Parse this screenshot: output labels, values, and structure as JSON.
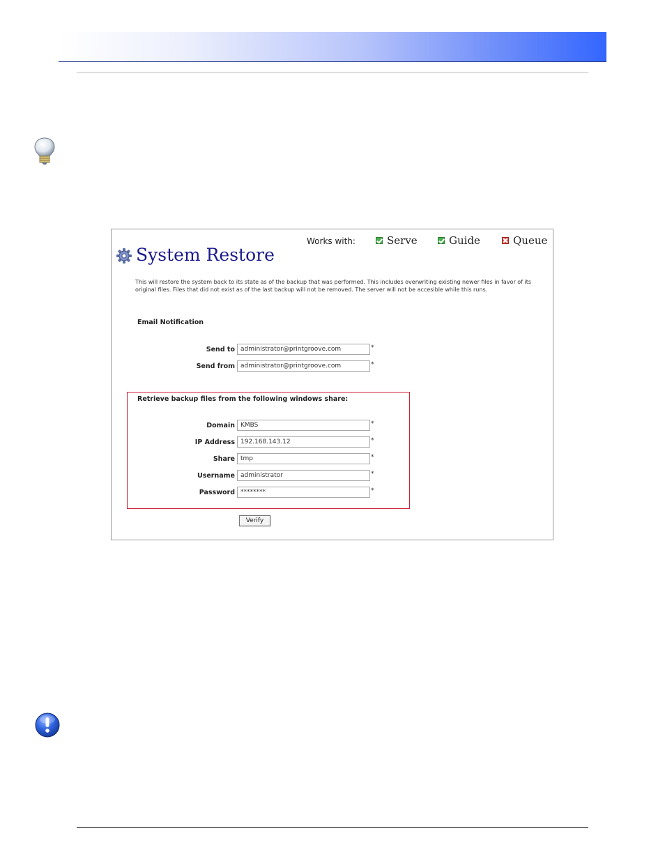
{
  "figure": {
    "title": "System Restore",
    "works_with_label": "Works with:",
    "products": [
      {
        "name": "Serve",
        "status": "supported"
      },
      {
        "name": "Guide",
        "status": "supported"
      },
      {
        "name": "Queue",
        "status": "not-supported"
      }
    ],
    "description": "This will restore the system back to its state as of the backup that was performed. This includes overwriting existing newer files in favor of its original files. Files that did not exist as of the last backup will not be removed. The server will not be accesible while this runs.",
    "email_section": {
      "heading": "Email Notification",
      "send_to_label": "Send to",
      "send_to_value": "administrator@printgroove.com",
      "send_from_label": "Send from",
      "send_from_value": "administrator@printgroove.com"
    },
    "share_section": {
      "heading": "Retrieve backup files from the following windows share:",
      "domain_label": "Domain",
      "domain_value": "KMBS",
      "ip_label": "IP Address",
      "ip_value": "192.168.143.12",
      "share_label": "Share",
      "share_value": "tmp",
      "username_label": "Username",
      "username_value": "administrator",
      "password_label": "Password",
      "password_value": "********"
    },
    "required_marker": "*",
    "verify_label": "Verify"
  },
  "colors": {
    "header_gradient_end": "#3366ff",
    "title_color": "#1a1a8c",
    "share_box_border": "#d0213a",
    "supported": "#4caf50",
    "not_supported": "#d9534f"
  }
}
